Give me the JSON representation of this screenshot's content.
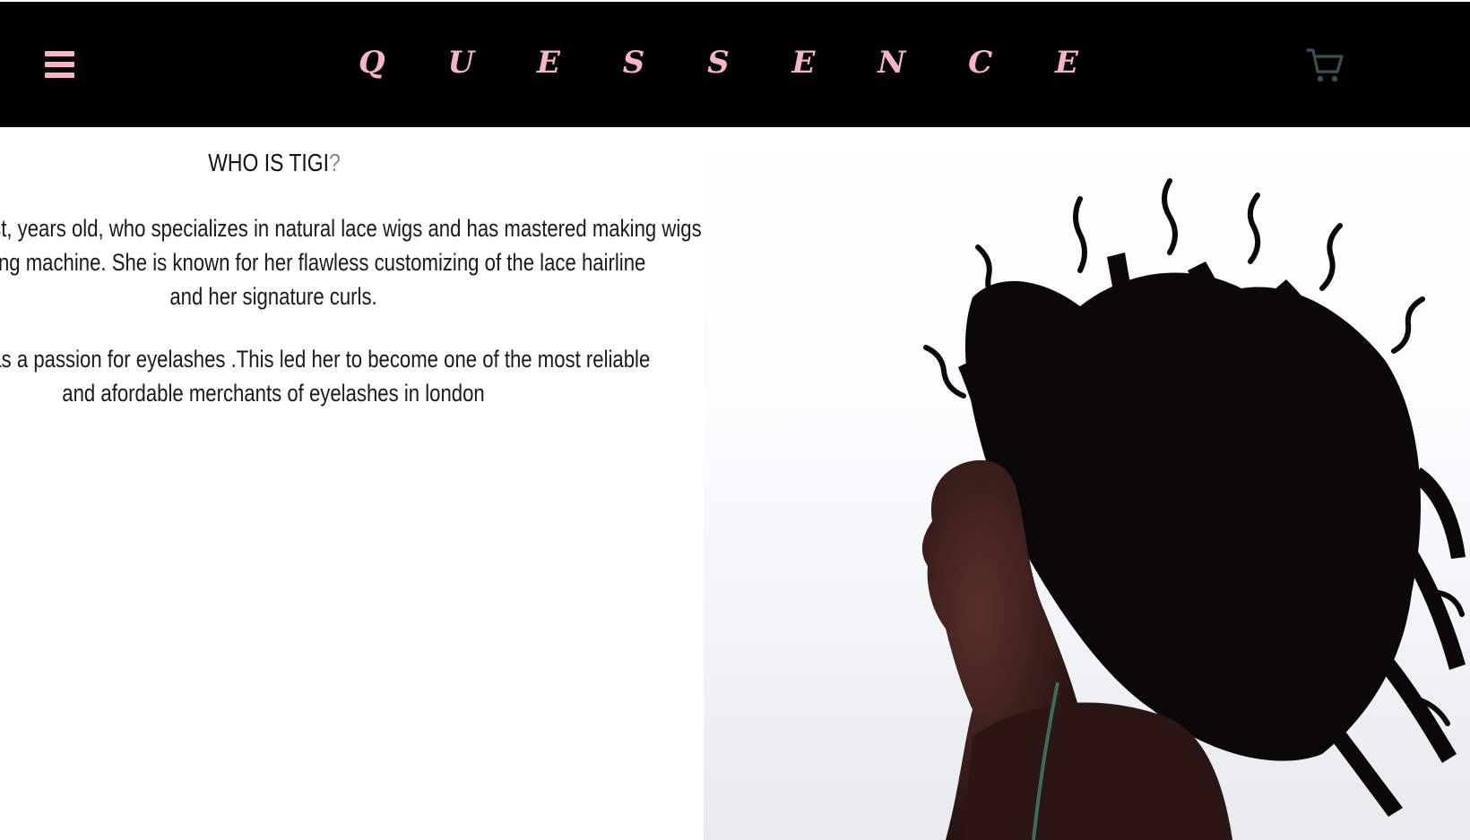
{
  "header": {
    "brand": "Q U E S S E N C E",
    "menu_icon": "hamburger-menu-icon",
    "cart_icon": "shopping-cart-icon"
  },
  "about": {
    "heading": "WHO IS TIGI",
    "heading_mark": "?",
    "paragraph_1": [
      "Tigi is a hair stylist, years old, who specializes in natural lace wigs and has mastered making wigs",
      "with a sewing machine. She is known for her flawless customizing of the lace hairline",
      "and her signature curls."
    ],
    "paragraph_2": [
      "She also has a passion for eyelashes .This led her to become one of the most reliable",
      "and afordable merchants of eyelashes in london"
    ]
  },
  "hero": {
    "image": "woman-with-flying-curly-hair-photo"
  },
  "colors": {
    "header_bg": "#000000",
    "brand_pink": "#f4b6c6",
    "menu_pink": "#f4b6c6",
    "cart_teal": "#3a4f4f",
    "text": "#1a1a1a"
  }
}
